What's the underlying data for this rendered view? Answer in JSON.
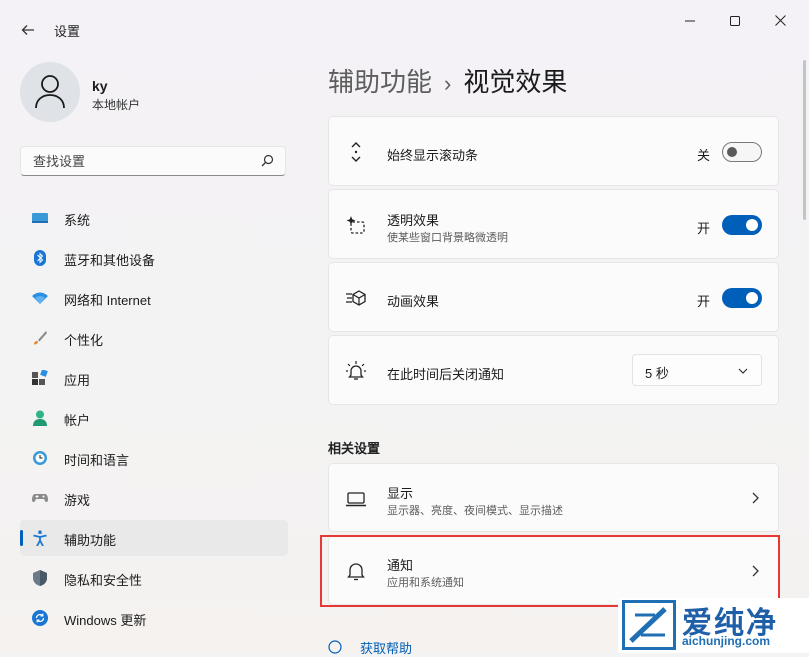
{
  "window": {
    "title": "设置"
  },
  "user": {
    "name": "ky",
    "account_type": "本地帐户"
  },
  "search": {
    "placeholder": "查找设置"
  },
  "sidebar": {
    "items": [
      {
        "label": "系统",
        "icon": "monitor-icon"
      },
      {
        "label": "蓝牙和其他设备",
        "icon": "bluetooth-icon"
      },
      {
        "label": "网络和 Internet",
        "icon": "wifi-icon"
      },
      {
        "label": "个性化",
        "icon": "brush-icon"
      },
      {
        "label": "应用",
        "icon": "apps-icon"
      },
      {
        "label": "帐户",
        "icon": "person-icon"
      },
      {
        "label": "时间和语言",
        "icon": "clock-globe-icon"
      },
      {
        "label": "游戏",
        "icon": "gamepad-icon"
      },
      {
        "label": "辅助功能",
        "icon": "accessibility-icon",
        "active": true
      },
      {
        "label": "隐私和安全性",
        "icon": "shield-icon"
      },
      {
        "label": "Windows 更新",
        "icon": "update-icon"
      }
    ]
  },
  "breadcrumb": {
    "parent": "辅助功能",
    "separator": "›",
    "current": "视觉效果"
  },
  "settings": {
    "scrollbars": {
      "title": "始终显示滚动条",
      "state_label": "关",
      "on": false
    },
    "transparency": {
      "title": "透明效果",
      "subtitle": "使某些窗口背景略微透明",
      "state_label": "开",
      "on": true
    },
    "animation": {
      "title": "动画效果",
      "state_label": "开",
      "on": true
    },
    "dismiss": {
      "title": "在此时间后关闭通知",
      "value": "5 秒"
    }
  },
  "related": {
    "heading": "相关设置",
    "display": {
      "title": "显示",
      "subtitle": "显示器、亮度、夜间模式、显示描述"
    },
    "notifications": {
      "title": "通知",
      "subtitle": "应用和系统通知"
    }
  },
  "help": {
    "label": "获取帮助"
  },
  "watermark": {
    "name": "爱纯净",
    "url": "aichunjing.com"
  },
  "colors": {
    "accent": "#005fb8",
    "highlight_box": "#e53935"
  }
}
